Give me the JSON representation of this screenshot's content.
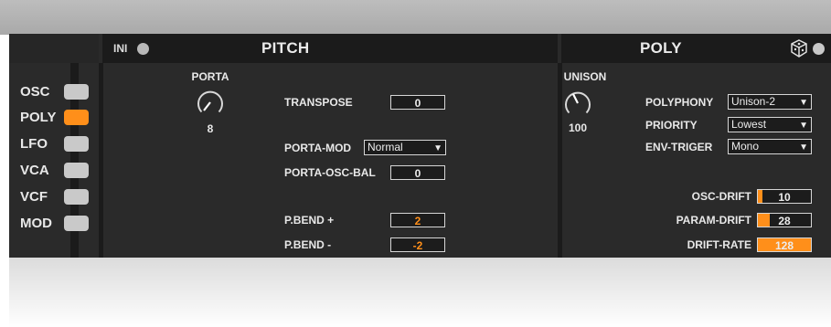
{
  "sidebar": {
    "items": [
      {
        "label": "OSC",
        "active": false
      },
      {
        "label": "POLY",
        "active": true
      },
      {
        "label": "LFO",
        "active": false
      },
      {
        "label": "VCA",
        "active": false
      },
      {
        "label": "VCF",
        "active": false
      },
      {
        "label": "MOD",
        "active": false
      }
    ]
  },
  "pitch": {
    "ini_label": "INI",
    "title": "PITCH",
    "porta": {
      "label": "PORTA",
      "value": "8"
    },
    "transpose": {
      "label": "TRANSPOSE",
      "value": "0"
    },
    "porta_mod": {
      "label": "PORTA-MOD",
      "value": "Normal"
    },
    "porta_osc_bal": {
      "label": "PORTA-OSC-BAL",
      "value": "0"
    },
    "pbend_plus": {
      "label": "P.BEND +",
      "value": "2"
    },
    "pbend_minus": {
      "label": "P.BEND -",
      "value": "-2"
    }
  },
  "poly": {
    "title": "POLY",
    "unison": {
      "label": "UNISON",
      "value": "100"
    },
    "polyphony": {
      "label": "POLYPHONY",
      "value": "Unison-2"
    },
    "priority": {
      "label": "PRIORITY",
      "value": "Lowest"
    },
    "env_triger": {
      "label": "ENV-TRIGER",
      "value": "Mono"
    },
    "osc_drift": {
      "label": "OSC-DRIFT",
      "value": "10",
      "fill": 0.08
    },
    "param_drift": {
      "label": "PARAM-DRIFT",
      "value": "28",
      "fill": 0.22
    },
    "drift_rate": {
      "label": "DRIFT-RATE",
      "value": "128",
      "fill": 1.0
    }
  },
  "colors": {
    "accent": "#ff8f1a",
    "panel": "#2a2a2a",
    "header": "#1b1b1b"
  }
}
